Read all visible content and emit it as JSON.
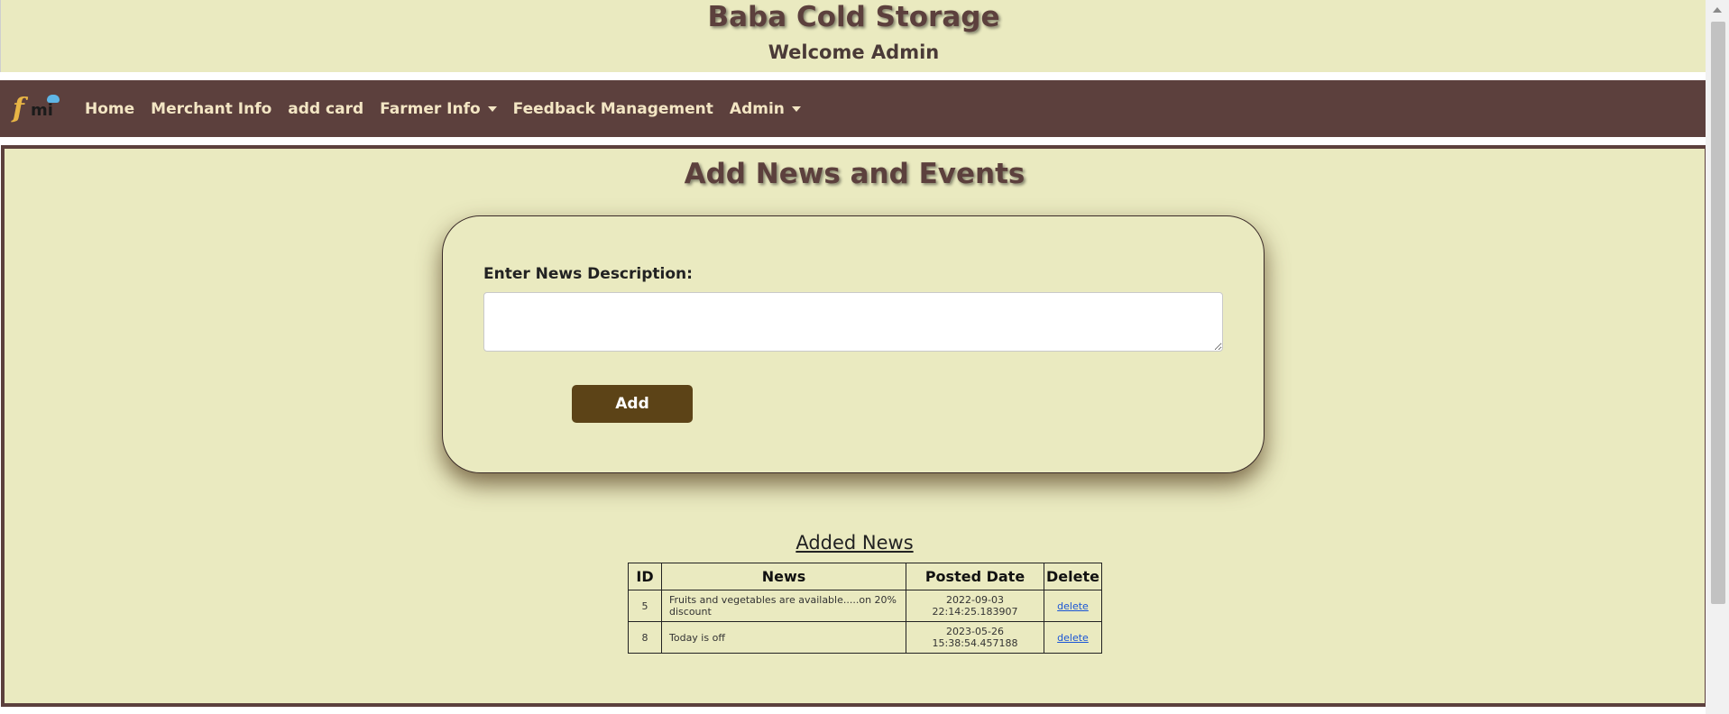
{
  "header": {
    "title": "Baba Cold Storage",
    "welcome": "Welcome Admin"
  },
  "navbar": {
    "brand": {
      "f": "f",
      "mi": "mi"
    },
    "items": [
      {
        "label": "Home",
        "dropdown": false
      },
      {
        "label": "Merchant Info",
        "dropdown": false
      },
      {
        "label": "add card",
        "dropdown": false
      },
      {
        "label": "Farmer Info",
        "dropdown": true
      },
      {
        "label": "Feedback Management",
        "dropdown": false
      },
      {
        "label": "Admin",
        "dropdown": true
      }
    ]
  },
  "form": {
    "title": "Add News and Events",
    "label": "Enter News Description:",
    "input_value": "",
    "button_label": "Add"
  },
  "table": {
    "title": "Added News",
    "headers": [
      "ID",
      "News",
      "Posted Date",
      "Delete"
    ],
    "rows": [
      {
        "id": "5",
        "news": "Fruits and vegetables are available.....on 20% discount",
        "date": "2022-09-03 22:14:25.183907",
        "delete": "delete"
      },
      {
        "id": "8",
        "news": "Today is off",
        "date": "2023-05-26 15:38:54.457188",
        "delete": "delete"
      }
    ]
  },
  "colors": {
    "accent": "#5c403d",
    "background": "#eaeac0",
    "button": "#5c4317"
  }
}
